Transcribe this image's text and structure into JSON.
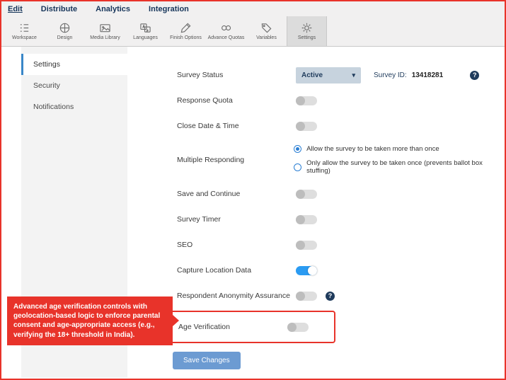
{
  "menu": {
    "items": [
      {
        "label": "Edit",
        "active": true
      },
      {
        "label": "Distribute",
        "active": false
      },
      {
        "label": "Analytics",
        "active": false
      },
      {
        "label": "Integration",
        "active": false
      }
    ]
  },
  "toolbar": {
    "items": [
      {
        "label": "Workspace",
        "icon": "workspace-icon"
      },
      {
        "label": "Design",
        "icon": "design-icon"
      },
      {
        "label": "Media Library",
        "icon": "media-library-icon"
      },
      {
        "label": "Languages",
        "icon": "languages-icon"
      },
      {
        "label": "Finish Options",
        "icon": "finish-options-icon"
      },
      {
        "label": "Advance Quotas",
        "icon": "advance-quotas-icon"
      },
      {
        "label": "Variables",
        "icon": "variables-icon"
      },
      {
        "label": "Settings",
        "icon": "settings-gear-icon",
        "active": true
      }
    ]
  },
  "sidebar": {
    "items": [
      {
        "label": "Settings",
        "active": true
      },
      {
        "label": "Security",
        "active": false
      },
      {
        "label": "Notifications",
        "active": false
      }
    ]
  },
  "settings": {
    "survey_status_label": "Survey Status",
    "survey_status_value": "Active",
    "survey_id_label": "Survey ID:",
    "survey_id_value": "13418281",
    "response_quota_label": "Response Quota",
    "close_date_label": "Close Date & Time",
    "multiple_responding_label": "Multiple Responding",
    "radio_more_than_once": "Allow the survey to be taken more than once",
    "radio_only_once": "Only allow the survey to be taken once (prevents ballot box stuffing)",
    "save_continue_label": "Save and Continue",
    "survey_timer_label": "Survey Timer",
    "seo_label": "SEO",
    "capture_location_label": "Capture Location Data",
    "respondent_anonymity_label": "Respondent Anonymity Assurance",
    "age_verification_label": "Age Verification",
    "save_changes_label": "Save Changes",
    "help_glyph": "?"
  },
  "annotation": {
    "text": "Advanced age verification controls with geolocation-based logic to enforce parental consent and age-appropriate access (e.g., verifying the 18+ threshold in India)."
  },
  "colors": {
    "annotation_red": "#e8332a",
    "accent_blue": "#2b9bf2",
    "navy": "#16355a",
    "dropdown_bg": "#c7d3de",
    "save_button_blue": "#6c9bd2"
  }
}
